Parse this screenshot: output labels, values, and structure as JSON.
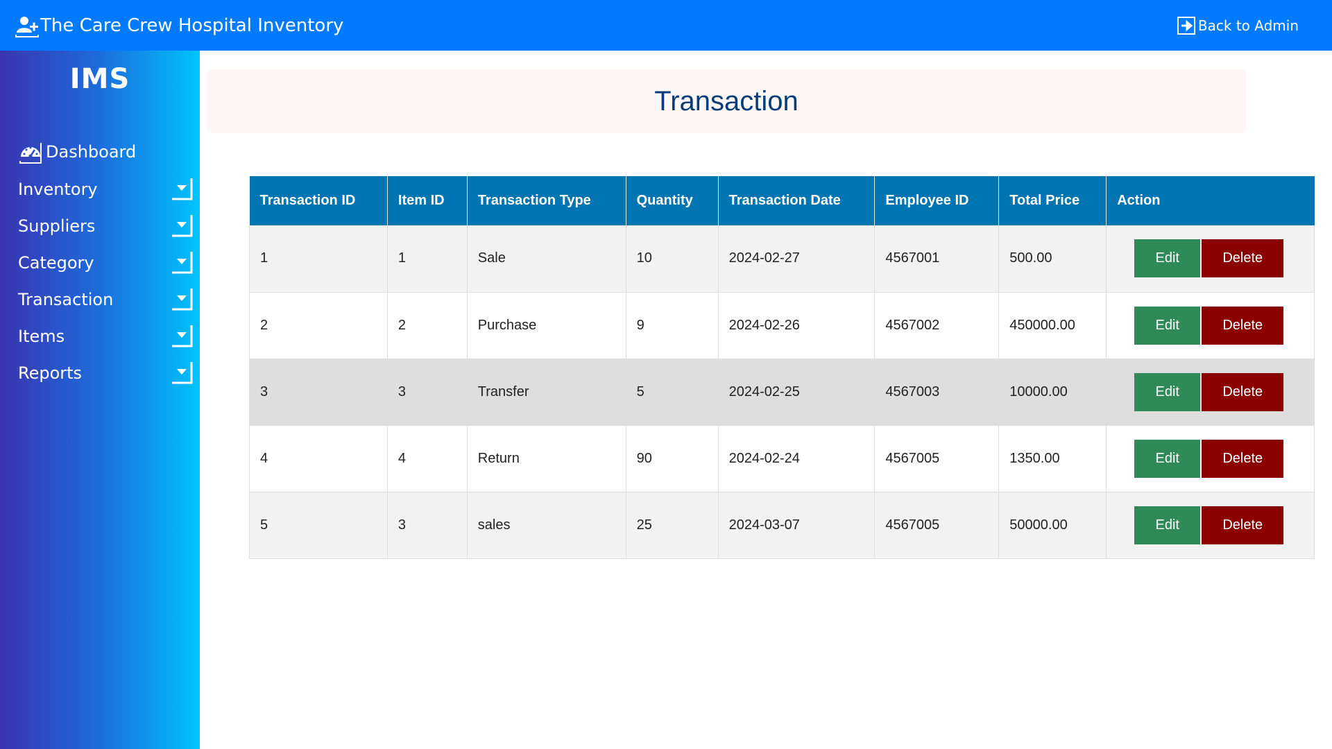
{
  "header": {
    "title": "The Care Crew Hospital Inventory",
    "brand_icon": "user-plus-icon",
    "back_label": "Back to Admin",
    "back_icon": "sign-out-icon"
  },
  "sidebar": {
    "logo": "IMS",
    "dashboard": {
      "label": "Dashboard",
      "icon": "gauge-icon"
    },
    "items": [
      {
        "label": "Inventory"
      },
      {
        "label": "Suppliers"
      },
      {
        "label": "Category"
      },
      {
        "label": "Transaction"
      },
      {
        "label": "Items"
      },
      {
        "label": "Reports"
      }
    ]
  },
  "main": {
    "title": "Transaction",
    "table": {
      "columns": [
        "Transaction ID",
        "Item ID",
        "Transaction Type",
        "Quantity",
        "Transaction Date",
        "Employee ID",
        "Total Price",
        "Action"
      ],
      "rows": [
        {
          "transaction_id": "1",
          "item_id": "1",
          "type": "Sale",
          "quantity": "10",
          "date": "2024-02-27",
          "employee_id": "4567001",
          "total_price": "500.00"
        },
        {
          "transaction_id": "2",
          "item_id": "2",
          "type": "Purchase",
          "quantity": "9",
          "date": "2024-02-26",
          "employee_id": "4567002",
          "total_price": "450000.00"
        },
        {
          "transaction_id": "3",
          "item_id": "3",
          "type": "Transfer",
          "quantity": "5",
          "date": "2024-02-25",
          "employee_id": "4567003",
          "total_price": "10000.00"
        },
        {
          "transaction_id": "4",
          "item_id": "4",
          "type": "Return",
          "quantity": "90",
          "date": "2024-02-24",
          "employee_id": "4567005",
          "total_price": "1350.00"
        },
        {
          "transaction_id": "5",
          "item_id": "3",
          "type": "sales",
          "quantity": "25",
          "date": "2024-03-07",
          "employee_id": "4567005",
          "total_price": "50000.00"
        }
      ],
      "edit_label": "Edit",
      "delete_label": "Delete"
    }
  },
  "colors": {
    "topbar": "#007bff",
    "table_header": "#0075b2",
    "edit_button": "#2e8b57",
    "delete_button": "#8b0000",
    "title_text": "#0a3d78"
  }
}
